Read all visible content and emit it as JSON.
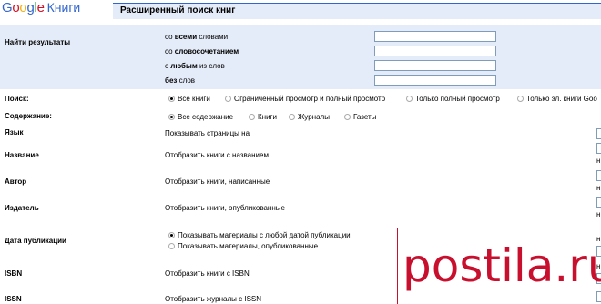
{
  "logo": {
    "google": "Google",
    "knigi": "Книги",
    "colors": [
      "#3366cc",
      "#d50f25",
      "#eeb211",
      "#3366cc",
      "#009925",
      "#d50f25"
    ]
  },
  "header": {
    "title": "Расширенный поиск книг"
  },
  "find": {
    "label": "Найти результаты",
    "rows": [
      {
        "pre": "со ",
        "bold": "всеми",
        "post": " словами"
      },
      {
        "pre": "со ",
        "bold": "словосочетанием",
        "post": ""
      },
      {
        "pre": "с ",
        "bold": "любым",
        "post": " из слов"
      },
      {
        "pre": "",
        "bold": "без",
        "post": " слов"
      }
    ]
  },
  "search": {
    "label": "Поиск:",
    "options": [
      "Все книги",
      "Ограниченный просмотр и полный просмотр",
      "Только полный просмотр",
      "Только эл. книги Goo"
    ],
    "selected": 0
  },
  "content": {
    "label": "Содержание:",
    "options": [
      "Все содержание",
      "Книги",
      "Журналы",
      "Газеты"
    ],
    "selected": 0
  },
  "fields": [
    {
      "label": "Язык",
      "desc": "Показывать страницы на"
    },
    {
      "label": "Название",
      "desc": "Отобразить книги с названием"
    },
    {
      "label": "Автор",
      "desc": "Отобразить книги, написанные"
    },
    {
      "label": "Издатель",
      "desc": "Отобразить книги, опубликованные"
    },
    {
      "label": "Дата публикации",
      "desc1": "Показывать материалы с любой датой публикации",
      "desc2": "Показывать материалы, опубликованные"
    },
    {
      "label": "ISBN",
      "desc": "Отобразить книги с ISBN"
    },
    {
      "label": "ISSN",
      "desc": "Отобразить журналы с ISSN"
    }
  ],
  "side_n": "н",
  "watermark": {
    "text": "postila.ru",
    "color": "#c8102e"
  }
}
